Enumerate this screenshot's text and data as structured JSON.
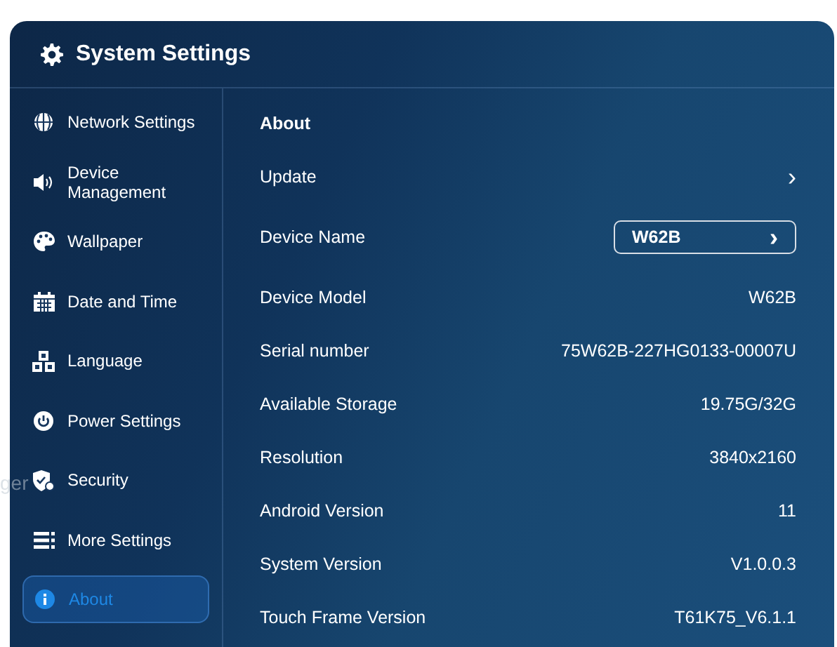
{
  "window": {
    "title": "System Settings"
  },
  "background_text": "ger",
  "sidebar": {
    "items": [
      {
        "label": "Network Settings",
        "selected": false
      },
      {
        "label": "Device Management",
        "selected": false
      },
      {
        "label": "Wallpaper",
        "selected": false
      },
      {
        "label": "Date and Time",
        "selected": false
      },
      {
        "label": "Language",
        "selected": false
      },
      {
        "label": "Power Settings",
        "selected": false
      },
      {
        "label": "Security",
        "selected": false
      },
      {
        "label": "More Settings",
        "selected": false
      },
      {
        "label": "About",
        "selected": true
      }
    ]
  },
  "content": {
    "heading": "About",
    "rows": [
      {
        "kind": "link",
        "label": "Update",
        "chevron": "›"
      },
      {
        "kind": "field",
        "label": "Device Name",
        "value": "W62B",
        "chevron": "›"
      },
      {
        "kind": "value",
        "label": "Device Model",
        "value": "W62B"
      },
      {
        "kind": "value",
        "label": "Serial number",
        "value": "75W62B-227HG0133-00007U"
      },
      {
        "kind": "value",
        "label": "Available Storage",
        "value": "19.75G/32G"
      },
      {
        "kind": "value",
        "label": "Resolution",
        "value": "3840x2160"
      },
      {
        "kind": "value",
        "label": "Android Version",
        "value": "11"
      },
      {
        "kind": "value",
        "label": "System Version",
        "value": "V1.0.0.3"
      },
      {
        "kind": "value",
        "label": "Touch Frame Version",
        "value": "T61K75_V6.1.1"
      }
    ]
  }
}
